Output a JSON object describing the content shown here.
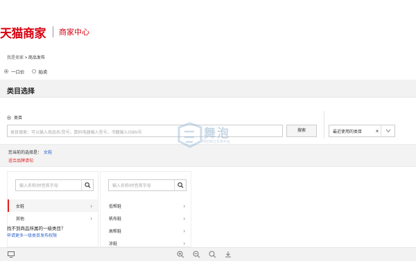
{
  "header": {
    "logo": "天猫商家",
    "subtitle": "商家中心"
  },
  "breadcrumb": {
    "home": "我是卖家",
    "separator": ">",
    "current": "商品发布"
  },
  "sale_type": {
    "options": [
      "一口价",
      "拍卖"
    ],
    "selected": "一口价"
  },
  "section": {
    "title": "类目选择"
  },
  "category_radio": {
    "label": "类目"
  },
  "search": {
    "placeholder": "类目搜索：可以输入商品名/货号，数码电器输入型号，书籍输入ISBN号",
    "button_label": "搜索"
  },
  "recent": {
    "value": "最近使用的类目",
    "clear_icon": "×"
  },
  "selected": {
    "prefix": "您当前的选择是：",
    "path": "女鞋",
    "brand_link": "适合品牌请勾"
  },
  "columns": [
    {
      "placeholder": "输入名称/拼音首字母",
      "items": [
        {
          "label": "女鞋",
          "active": true
        },
        {
          "label": "其他",
          "active": false
        }
      ]
    },
    {
      "placeholder": "输入名称/拼音首字母",
      "items": [
        {
          "label": "低帮鞋",
          "active": false
        },
        {
          "label": "帆布鞋",
          "active": false
        },
        {
          "label": "高帮鞋",
          "active": false
        },
        {
          "label": "凉鞋",
          "active": false
        }
      ]
    }
  ],
  "help": {
    "not_found": "找不到商品所属的一级类目？",
    "apply_link": "申请更多一级类目发布权限"
  },
  "watermark": {
    "text": "舞泡",
    "sub": "网店转让交易平台"
  },
  "icons": {
    "chevron": "chevron-right-icon",
    "search": "search-icon",
    "zoom_in": "zoom-in-icon",
    "zoom_out": "zoom-out-icon",
    "refresh": "rotate-icon",
    "download": "download-icon",
    "monitor": "monitor-icon"
  },
  "colors": {
    "brand_red": "#d6000f",
    "link_blue": "#3366cc",
    "warning_red": "#e02020"
  }
}
